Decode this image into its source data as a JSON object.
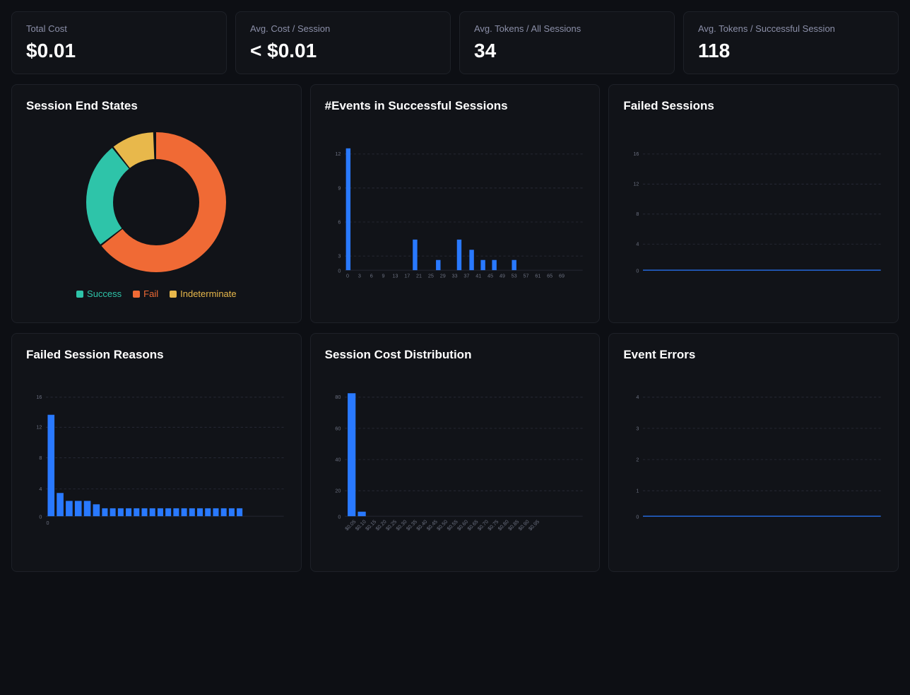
{
  "metrics": [
    {
      "label": "Total Cost",
      "value": "$0.01"
    },
    {
      "label": "Avg. Cost / Session",
      "value": "< $0.01"
    },
    {
      "label": "Avg. Tokens / All Sessions",
      "value": "34"
    },
    {
      "label": "Avg. Tokens / Successful Session",
      "value": "118"
    }
  ],
  "charts": {
    "session_end_states": {
      "title": "Session End States",
      "segments": [
        {
          "label": "Success",
          "color": "#2ec4a9",
          "percent": 25
        },
        {
          "label": "Fail",
          "color": "#f06a35",
          "percent": 65
        },
        {
          "label": "Indeterminate",
          "color": "#e8b84b",
          "percent": 10
        }
      ]
    },
    "events_successful": {
      "title": "#Events in Successful Sessions",
      "y_max": 12,
      "y_ticks": [
        0,
        3,
        6,
        9,
        12
      ],
      "x_labels": [
        "0",
        "3",
        "6",
        "9",
        "13",
        "17",
        "21",
        "25",
        "29",
        "33",
        "37",
        "41",
        "45",
        "49",
        "53",
        "57",
        "61",
        "65",
        "69"
      ],
      "bars": [
        12,
        0,
        0,
        0,
        0,
        0,
        0,
        3,
        0,
        0,
        1,
        0,
        3,
        0,
        2,
        1,
        1,
        0,
        1
      ]
    },
    "failed_sessions": {
      "title": "Failed Sessions",
      "y_max": 16,
      "y_ticks": [
        0,
        4,
        8,
        12,
        16
      ],
      "bars": []
    },
    "failed_reasons": {
      "title": "Failed Session Reasons",
      "y_max": 16,
      "y_ticks": [
        0,
        4,
        8,
        12,
        16
      ],
      "bars": [
        13,
        3,
        2,
        2,
        2,
        1.5,
        1,
        1,
        1,
        1,
        1,
        1,
        1,
        1,
        1,
        1,
        1,
        1,
        1,
        1,
        1,
        1,
        1,
        1
      ]
    },
    "cost_distribution": {
      "title": "Session Cost Distribution",
      "y_max": 80,
      "y_ticks": [
        0,
        20,
        40,
        60,
        80
      ],
      "x_labels": [
        "$0.05",
        "$0.10",
        "$0.15",
        "$0.20",
        "$0.25",
        "$0.30",
        "$0.35",
        "$0.40",
        "$0.45",
        "$0.50",
        "$0.55",
        "$0.60",
        "$0.65",
        "$0.70",
        "$0.75",
        "$0.80",
        "$0.85",
        "$0.90",
        "$0.95"
      ],
      "bars": [
        79,
        3,
        0,
        0,
        0,
        0,
        0,
        0,
        0,
        0,
        0,
        0,
        0,
        0,
        0,
        0,
        0,
        0,
        0
      ]
    },
    "event_errors": {
      "title": "Event Errors",
      "y_max": 4,
      "y_ticks": [
        0,
        1,
        2,
        3,
        4
      ],
      "bars": []
    }
  }
}
